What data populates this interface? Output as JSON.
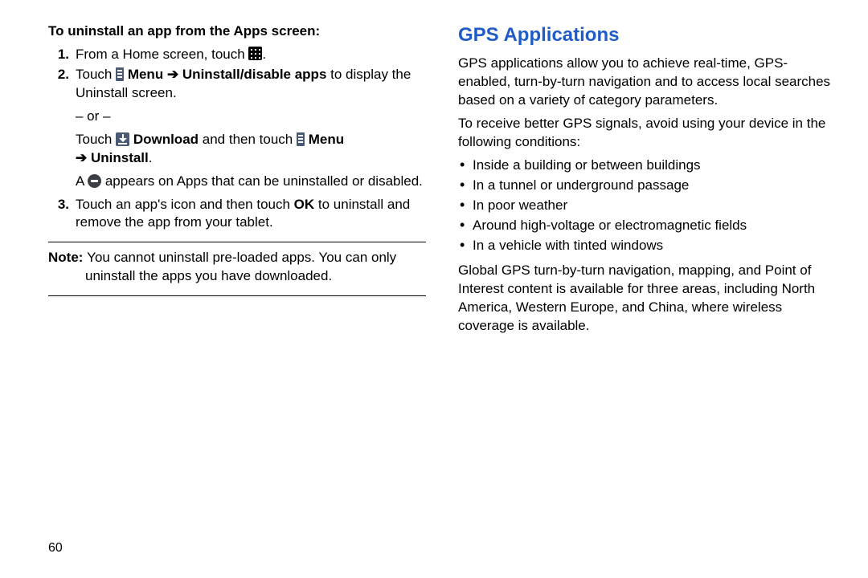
{
  "left": {
    "subhead": "To uninstall an app from the Apps screen:",
    "steps": {
      "one": {
        "num": "1.",
        "a": "From a Home screen, touch ",
        "b": "."
      },
      "two": {
        "num": "2.",
        "a": "Touch ",
        "menu": " Menu ",
        "arrow1": "➔ ",
        "uninstallDisable": "Uninstall/disable apps",
        "b": " to display the Uninstall screen.",
        "or": "– or –",
        "c": "Touch ",
        "download": " Download",
        "d": " and then touch ",
        "menu2": " Menu ",
        "arrow2": "➔ ",
        "uninstall": "Uninstall",
        "e": ".",
        "f1": "A ",
        "f2": " appears on Apps that can be uninstalled or disabled."
      },
      "three": {
        "num": "3.",
        "a": "Touch an app's icon and then touch ",
        "ok": "OK",
        "b": " to uninstall and remove the app from your tablet."
      }
    },
    "note": {
      "label": "Note: ",
      "line1": "You cannot uninstall pre-loaded apps. You can only",
      "line2": "uninstall the apps you have downloaded."
    }
  },
  "right": {
    "title": "GPS Applications",
    "para1": "GPS applications allow you to achieve real-time, GPS-enabled, turn-by-turn navigation and to access local searches based on a variety of category parameters.",
    "para2": "To receive better GPS signals, avoid using your device in the following conditions:",
    "bullets": [
      "Inside a building or between buildings",
      "In a tunnel or underground passage",
      "In poor weather",
      "Around high-voltage or electromagnetic fields",
      "In a vehicle with tinted windows"
    ],
    "para3": "Global GPS turn-by-turn navigation, mapping, and Point of Interest content is available for three areas, including North America, Western Europe, and China, where wireless coverage is available."
  },
  "pageNumber": "60"
}
